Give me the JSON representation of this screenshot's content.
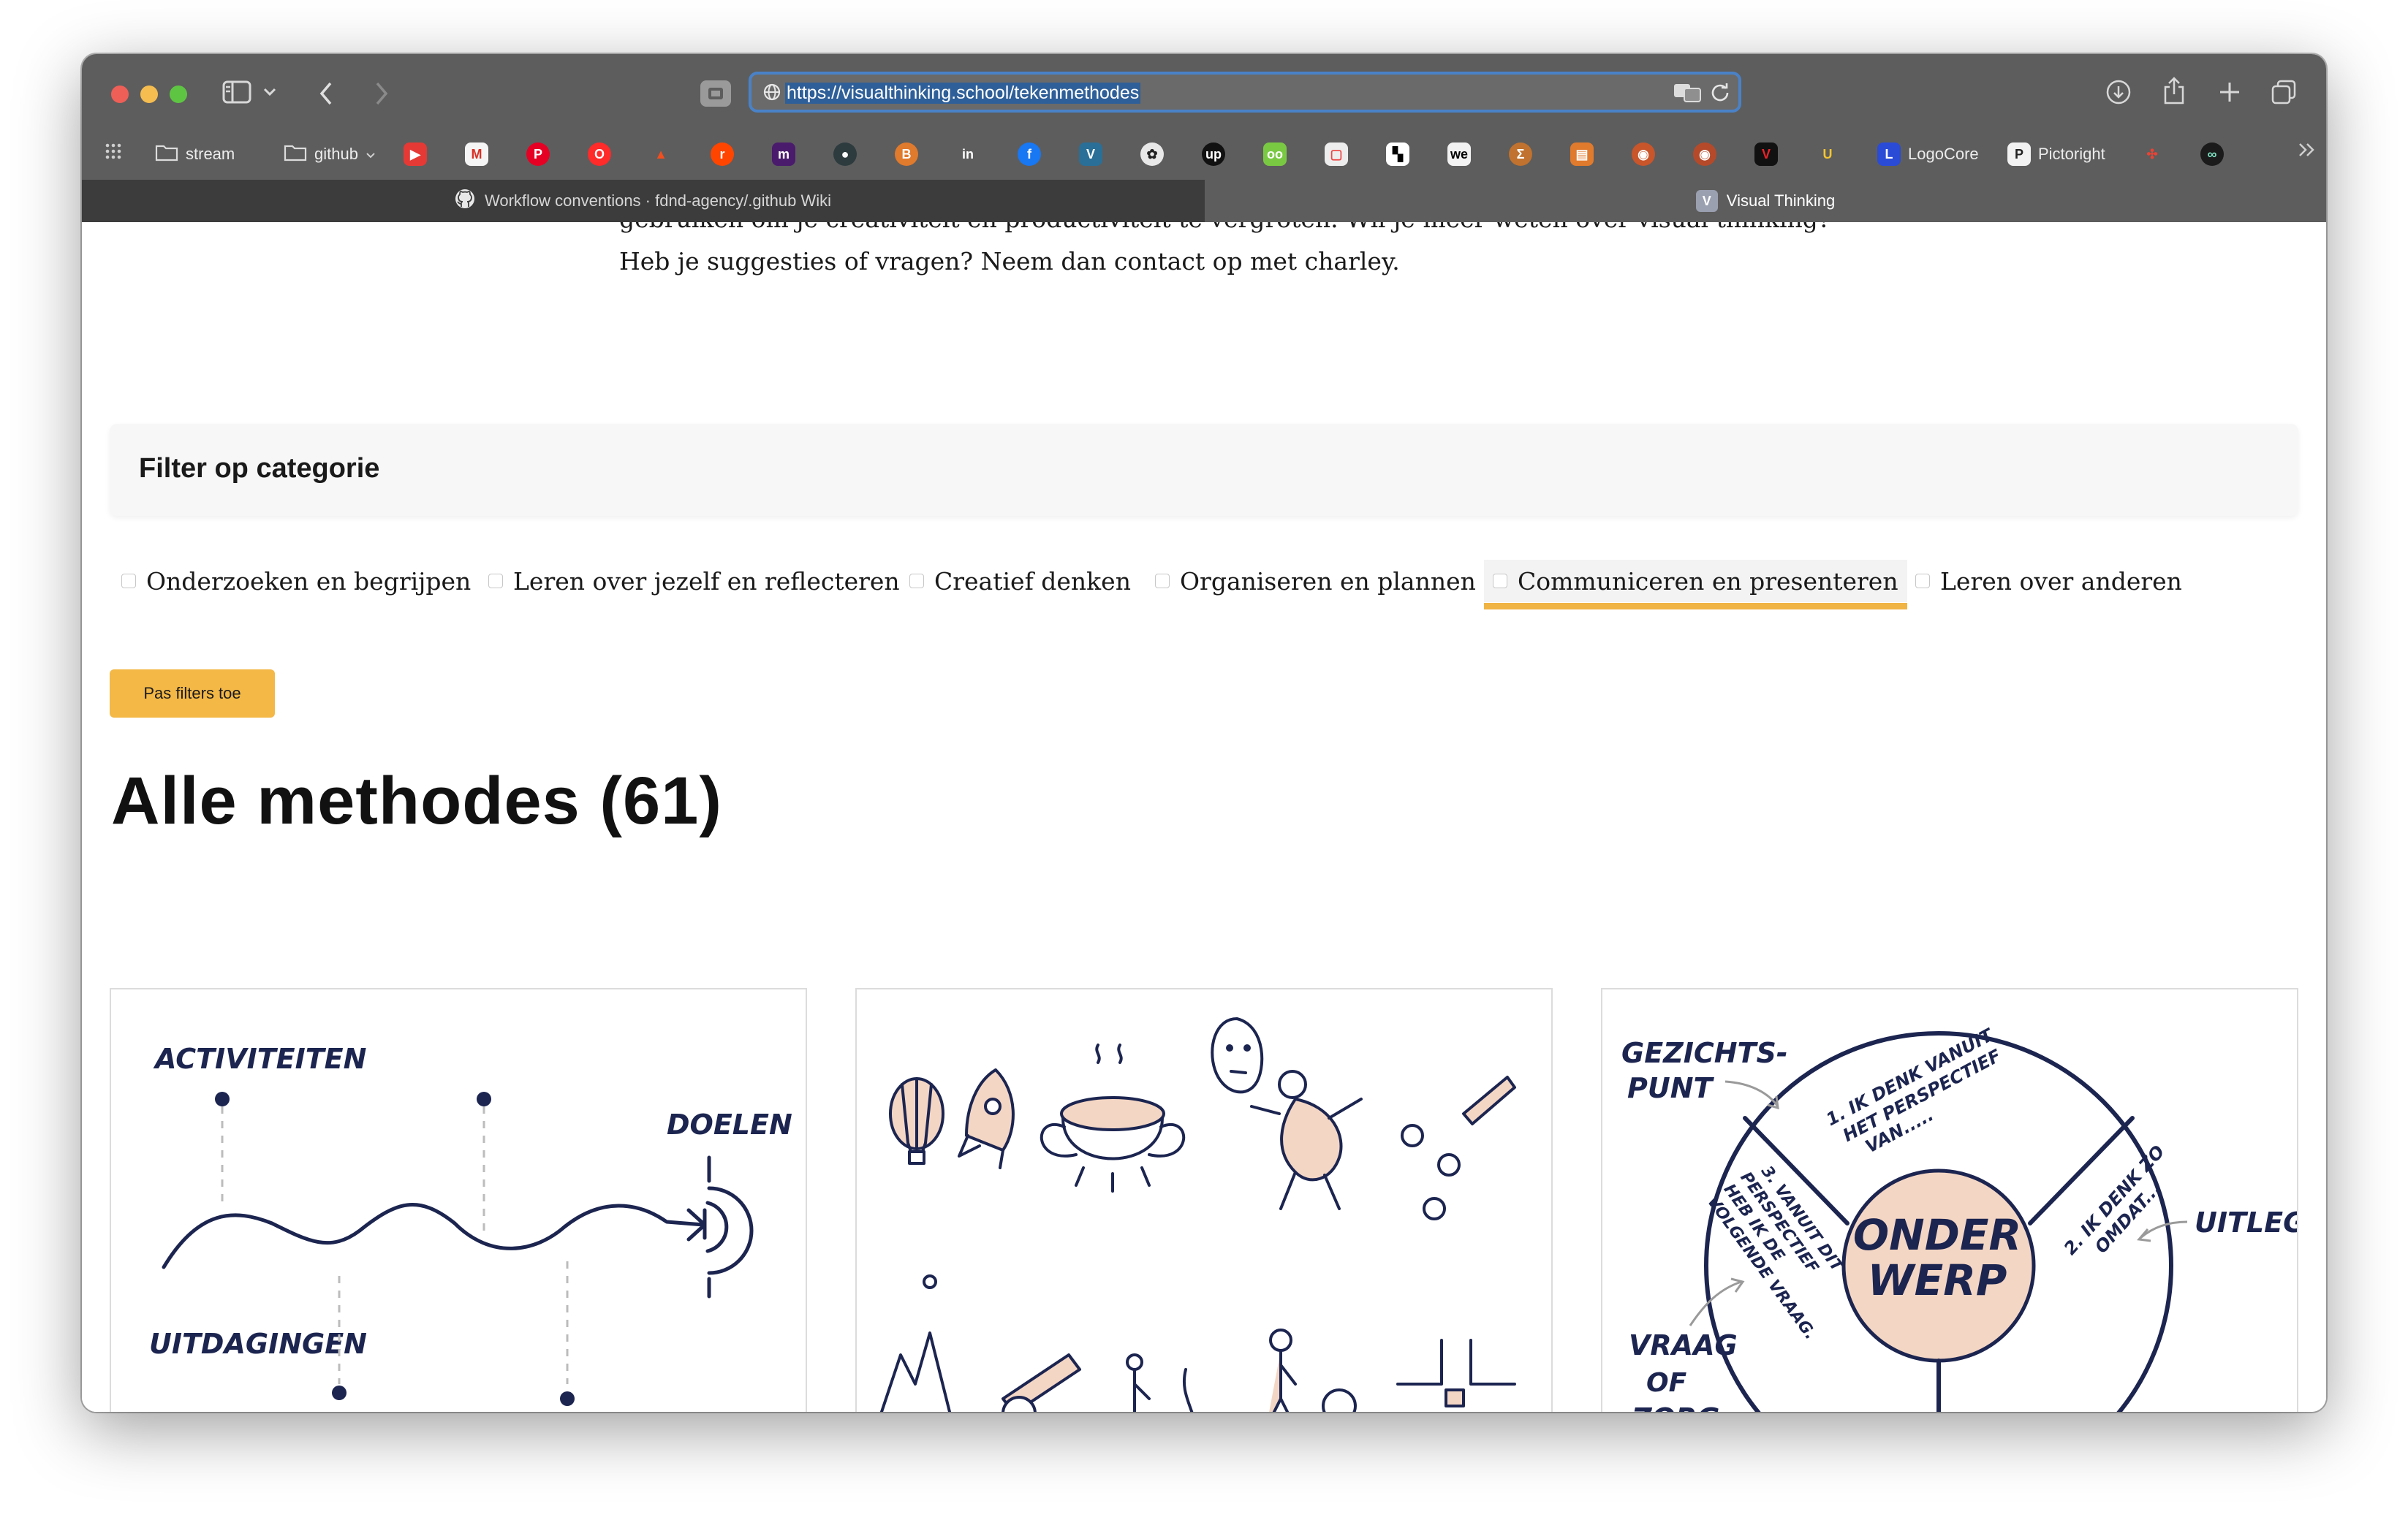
{
  "browser": {
    "url": "https://visualthinking.school/tekenmethodes",
    "bookmarks": [
      {
        "label": "stream",
        "icon": "folder-icon"
      },
      {
        "label": "github",
        "icon": "folder-icon"
      },
      {
        "label": "LogoCore",
        "icon": "logocore-icon"
      },
      {
        "label": "Pictoright",
        "icon": "pictoright-icon"
      }
    ],
    "tabs": [
      {
        "label": "Workflow conventions · fdnd-agency/.github Wiki",
        "icon": "github-icon",
        "active": false
      },
      {
        "label": "Visual Thinking",
        "icon": "v-icon",
        "active": true
      }
    ]
  },
  "intro": {
    "line1": "gebruiken om je creativiteit en productiviteit te vergroten. Wil je meer weten over visual thinking?",
    "line2": "Heb je suggesties of vragen? Neem dan contact op met charley."
  },
  "filter": {
    "title": "Filter op categorie",
    "categories": [
      "Onderzoeken en begrijpen",
      "Leren over jezelf en reflecteren",
      "Creatief denken",
      "Organiseren en plannen",
      "Communiceren en presenteren",
      "Leren over anderen"
    ],
    "hovered": "Communiceren en presenteren",
    "apply_label": "Pas filters toe"
  },
  "methods": {
    "heading": "Alle methodes (61)",
    "card1": {
      "labels": [
        "ACTIVITEITEN",
        "DOELEN",
        "UITDAGINGEN"
      ]
    },
    "card3": {
      "labels": [
        "GEZICHTS-",
        "PUNT",
        "UITLEG",
        "VRAAG",
        "OF",
        "ZORG"
      ],
      "center": [
        "ONDER",
        "WERP"
      ],
      "segments": [
        "1. IK DENK VANUIT",
        "HET PERSPECTIEF",
        "VAN.....",
        "2. IK DENK ZO",
        "OMDAT...",
        "3. VANUIT DIT",
        "PERSPECTIEF",
        "HEB IK DE",
        "VOLGENDE VRAAG."
      ]
    }
  },
  "colors": {
    "accent": "#f0b444",
    "ink": "#1c2550",
    "peach": "#f4d6c4",
    "toolbar": "#5d5d5d"
  }
}
